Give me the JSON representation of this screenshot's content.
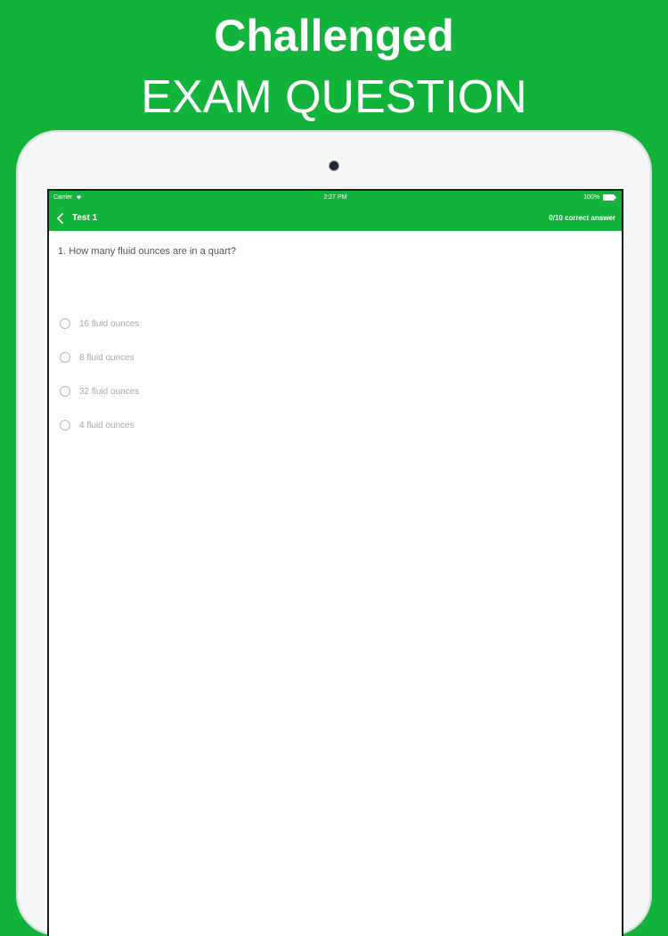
{
  "promo": {
    "line1": "Challenged",
    "line2": "EXAM QUESTION"
  },
  "status_bar": {
    "carrier": "Carrier",
    "time": "2:27 PM",
    "battery": "100%"
  },
  "nav": {
    "back_icon": "chevron-left-icon",
    "title": "Test 1",
    "score": "0/10 correct answer"
  },
  "question": {
    "text": "1. How many fluid ounces are in a quart?",
    "options": [
      {
        "label": "16 fluid ounces"
      },
      {
        "label": "8 fluid ounces"
      },
      {
        "label": "32 fluid ounces"
      },
      {
        "label": "4 fluid ounces"
      }
    ]
  },
  "colors": {
    "brand_green": "#11b33a",
    "tablet_frame": "#f6f7f8",
    "option_text": "#a8a8a8"
  }
}
